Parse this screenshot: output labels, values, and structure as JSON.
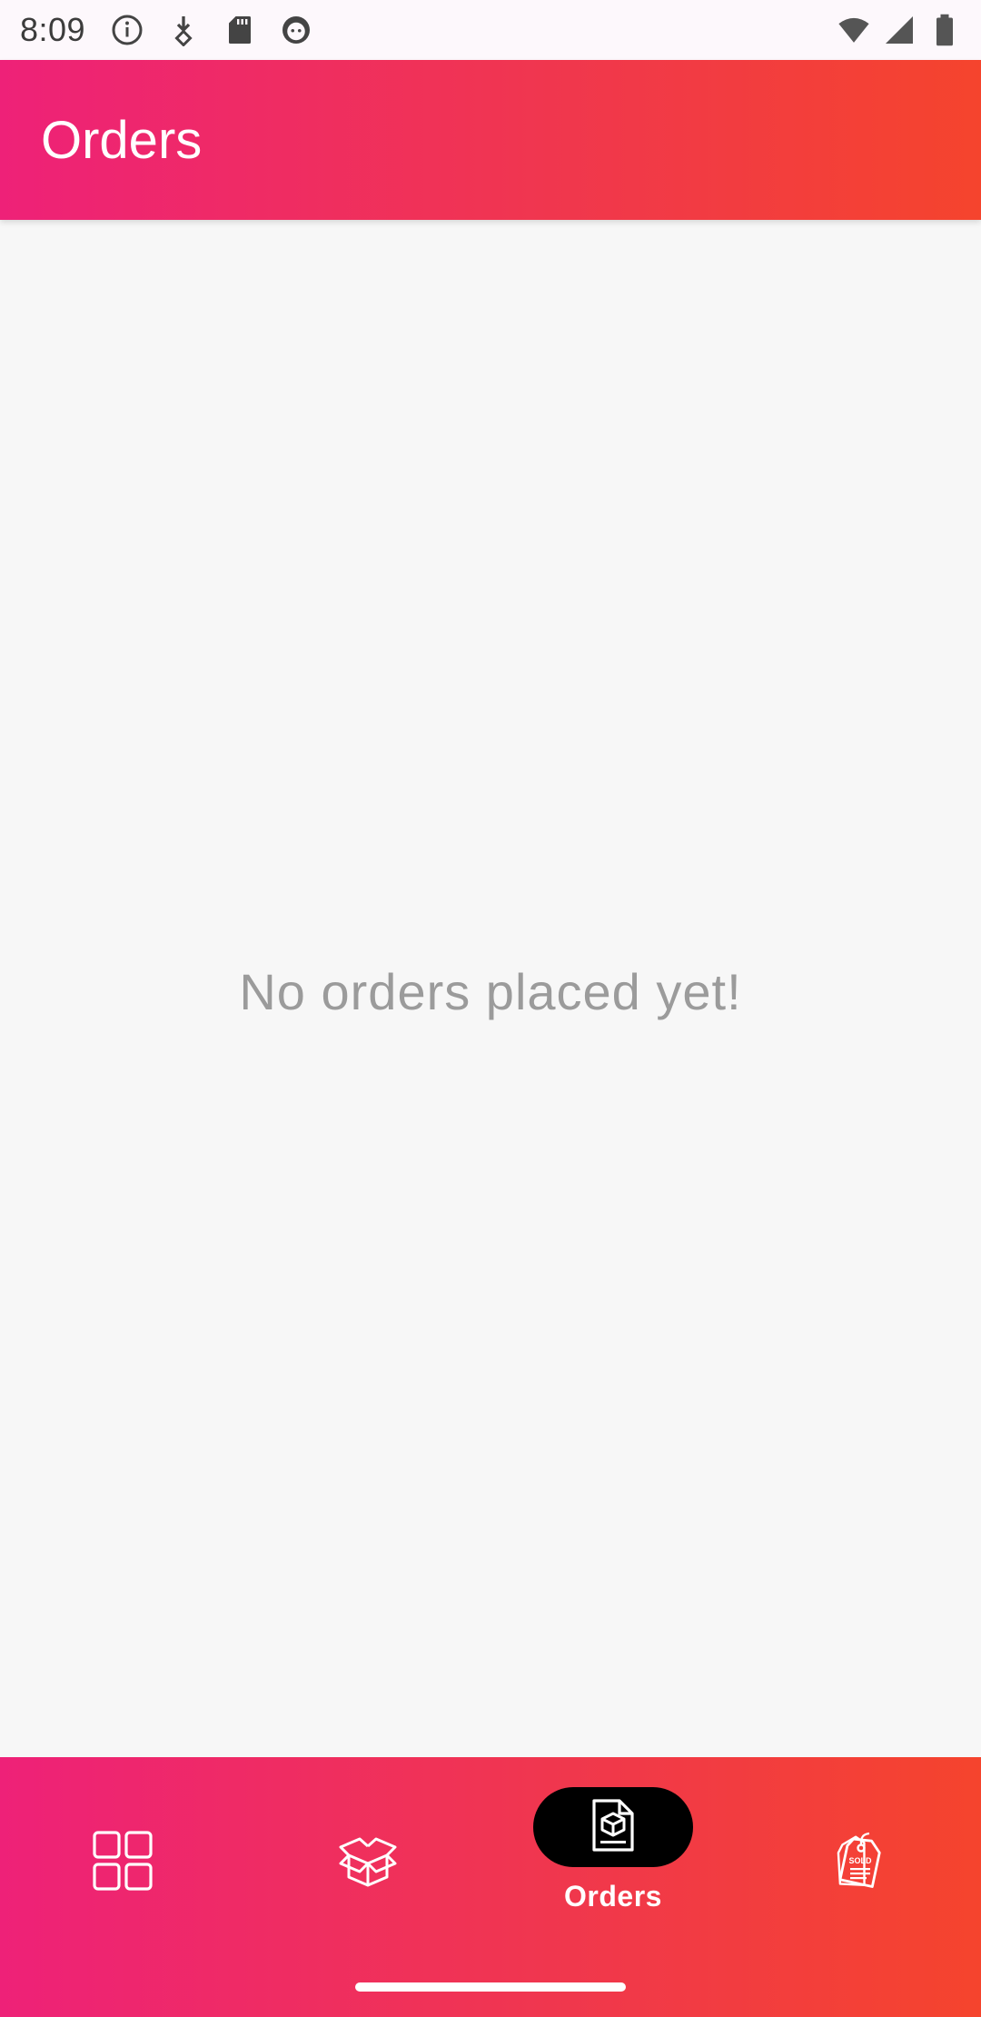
{
  "status_bar": {
    "time": "8:09",
    "left_icons": [
      "info-icon",
      "download-icon",
      "sd-card-icon",
      "face-icon"
    ],
    "right_icons": [
      "wifi-icon",
      "signal-icon",
      "battery-icon"
    ]
  },
  "app_bar": {
    "title": "Orders",
    "gradient": [
      "#ee2178",
      "#f5442d"
    ]
  },
  "main": {
    "empty_message": "No orders placed yet!"
  },
  "bottom_nav": {
    "items": [
      {
        "icon": "dashboard-grid-icon",
        "label": "",
        "active": false
      },
      {
        "icon": "products-box-icon",
        "label": "",
        "active": false
      },
      {
        "icon": "orders-document-icon",
        "label": "Orders",
        "active": true
      },
      {
        "icon": "sold-tag-icon",
        "label": "",
        "active": false
      }
    ],
    "sold_tag_text": "SOLD"
  },
  "colors": {
    "accent_start": "#ee2178",
    "accent_end": "#f5442d",
    "background": "#f7f7f7",
    "empty_text": "#9b9b9b",
    "active_pill": "#000000"
  }
}
